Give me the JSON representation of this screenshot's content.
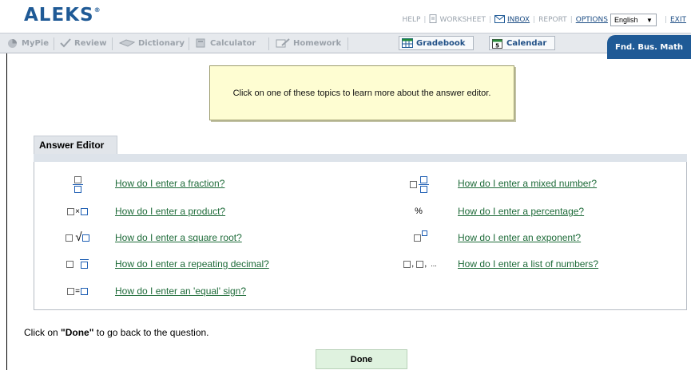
{
  "header": {
    "logo": "ALEKS",
    "logo_mark": "®",
    "links": {
      "help": "HELP",
      "worksheet": "WORKSHEET",
      "inbox": "INBOX",
      "report": "REPORT",
      "options": "OPTIONS",
      "exit": "EXIT"
    },
    "language": "English"
  },
  "tabs": [
    {
      "label": "MyPie",
      "icon": "pie-icon"
    },
    {
      "label": "Review",
      "icon": "check-pen-icon"
    },
    {
      "label": "Dictionary",
      "icon": "book-icon"
    },
    {
      "label": "Calculator",
      "icon": "calculator-icon"
    },
    {
      "label": "Homework",
      "icon": "homework-icon"
    },
    {
      "label": "Gradebook",
      "icon": "gradebook-icon"
    },
    {
      "label": "Calendar",
      "icon": "calendar-icon",
      "day": "5"
    }
  ],
  "course": "Fnd. Bus. Math",
  "info_box": "Click on one of these topics to learn more about the answer editor.",
  "editor": {
    "title": "Answer Editor",
    "items": [
      {
        "link": "How do I enter a fraction?",
        "icon": "fraction-icon"
      },
      {
        "link": "How do I enter a mixed number?",
        "icon": "mixed-number-icon"
      },
      {
        "link": "How do I enter a product?",
        "icon": "product-icon",
        "symbol": "×"
      },
      {
        "link": "How do I enter a percentage?",
        "icon": "percent-icon",
        "symbol": "%"
      },
      {
        "link": "How do I enter a square root?",
        "icon": "square-root-icon",
        "symbol": "√"
      },
      {
        "link": "How do I enter an exponent?",
        "icon": "exponent-icon"
      },
      {
        "link": "How do I enter a repeating decimal?",
        "icon": "repeating-decimal-icon"
      },
      {
        "link": "How do I enter a list of numbers?",
        "icon": "list-icon",
        "symbol": ",",
        "ellipsis": "..."
      },
      {
        "link": "How do I enter an 'equal' sign?",
        "icon": "equal-sign-icon",
        "symbol": "="
      }
    ]
  },
  "footer": {
    "instruction_prefix": "Click on ",
    "instruction_bold": "\"Done\"",
    "instruction_suffix": " to go back to the question.",
    "done_label": "Done"
  },
  "colors": {
    "brand_blue": "#1f5a96",
    "link_green": "#1e6b39",
    "info_bg": "#fefdd2",
    "done_bg": "#dff2df"
  }
}
